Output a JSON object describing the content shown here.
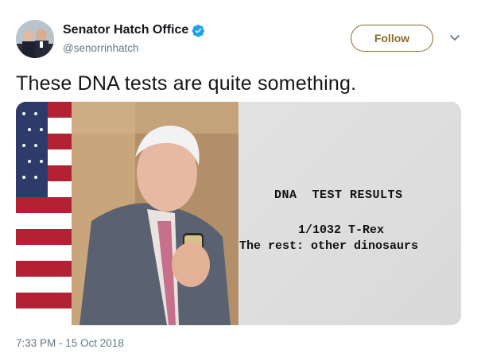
{
  "account": {
    "display_name": "Senator Hatch Office",
    "handle": "@senorrinhatch",
    "verified": true,
    "avatar_icon": "avatar-photo"
  },
  "actions": {
    "follow_label": "Follow",
    "more_icon": "chevron-down-icon"
  },
  "tweet": {
    "text": "These DNA tests are quite something.",
    "timestamp": "7:33 PM - 15 Oct 2018"
  },
  "media": {
    "panel_title": "DNA  TEST RESULTS",
    "result_line1": "1/1032 T-Rex",
    "result_line2": "The rest: other dinosaurs"
  },
  "colors": {
    "follow_accent": "#8a6a2d",
    "verified_blue": "#1da1f2",
    "muted_text": "#657786"
  }
}
